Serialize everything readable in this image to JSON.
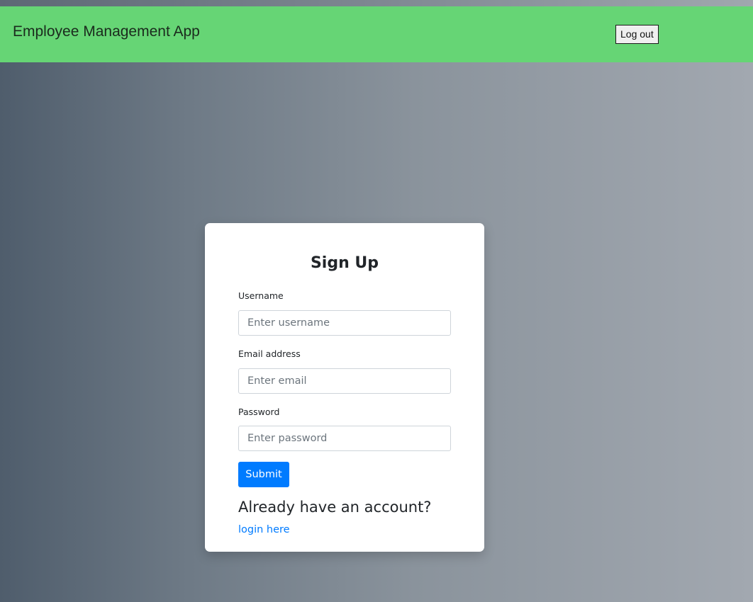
{
  "navbar": {
    "brand": "Employee Management App",
    "logout_label": "Log out",
    "color": "#66d575"
  },
  "form": {
    "title": "Sign Up",
    "username": {
      "label": "Username",
      "placeholder": "Enter username",
      "value": ""
    },
    "email": {
      "label": "Email address",
      "placeholder": "Enter email",
      "value": ""
    },
    "password": {
      "label": "Password",
      "placeholder": "Enter password",
      "value": ""
    },
    "submit_label": "Submit",
    "submit_color": "#007bff",
    "already_text": "Already have an account?",
    "login_link": "login here"
  }
}
